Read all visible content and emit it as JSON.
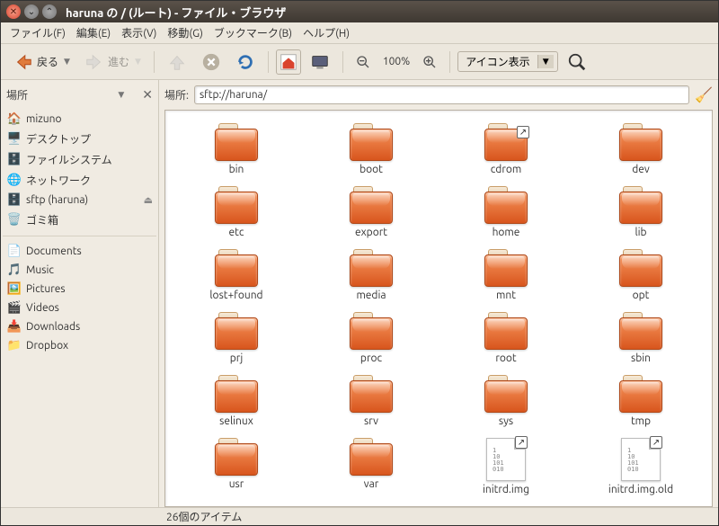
{
  "window_title": "haruna の / (ルート) - ファイル・ブラウザ",
  "menu": [
    "ファイル(F)",
    "編集(E)",
    "表示(V)",
    "移動(G)",
    "ブックマーク(B)",
    "ヘルプ(H)"
  ],
  "toolbar": {
    "back": "戻る",
    "forward": "進む",
    "zoom": "100%",
    "view_mode": "アイコン表示"
  },
  "side": {
    "header": "場所",
    "places": [
      {
        "icon": "🏠",
        "label": "mizuno",
        "color": "#d9432e"
      },
      {
        "icon": "🖥️",
        "label": "デスクトップ",
        "color": "#7a4ea0"
      },
      {
        "icon": "🗄️",
        "label": "ファイルシステム",
        "color": "#888"
      },
      {
        "icon": "🌐",
        "label": "ネットワーク",
        "color": "#4a7dbf"
      },
      {
        "icon": "🗄️",
        "label": "sftp (haruna)",
        "color": "#888",
        "eject": true
      },
      {
        "icon": "🗑️",
        "label": "ゴミ箱",
        "color": "#888"
      }
    ],
    "bookmarks": [
      {
        "icon": "📄",
        "label": "Documents"
      },
      {
        "icon": "🎵",
        "label": "Music"
      },
      {
        "icon": "🖼️",
        "label": "Pictures"
      },
      {
        "icon": "🎬",
        "label": "Videos"
      },
      {
        "icon": "📥",
        "label": "Downloads"
      },
      {
        "icon": "📁",
        "label": "Dropbox"
      }
    ]
  },
  "location": {
    "label": "場所:",
    "value": "sftp://haruna/"
  },
  "items": [
    {
      "name": "bin",
      "type": "folder"
    },
    {
      "name": "boot",
      "type": "folder"
    },
    {
      "name": "cdrom",
      "type": "folder",
      "link": true
    },
    {
      "name": "dev",
      "type": "folder"
    },
    {
      "name": "etc",
      "type": "folder"
    },
    {
      "name": "export",
      "type": "folder"
    },
    {
      "name": "home",
      "type": "folder"
    },
    {
      "name": "lib",
      "type": "folder"
    },
    {
      "name": "lost+found",
      "type": "folder"
    },
    {
      "name": "media",
      "type": "folder"
    },
    {
      "name": "mnt",
      "type": "folder"
    },
    {
      "name": "opt",
      "type": "folder"
    },
    {
      "name": "prj",
      "type": "folder"
    },
    {
      "name": "proc",
      "type": "folder"
    },
    {
      "name": "root",
      "type": "folder"
    },
    {
      "name": "sbin",
      "type": "folder"
    },
    {
      "name": "selinux",
      "type": "folder"
    },
    {
      "name": "srv",
      "type": "folder"
    },
    {
      "name": "sys",
      "type": "folder"
    },
    {
      "name": "tmp",
      "type": "folder"
    },
    {
      "name": "usr",
      "type": "folder"
    },
    {
      "name": "var",
      "type": "folder"
    },
    {
      "name": "initrd.img",
      "type": "file",
      "link": true
    },
    {
      "name": "initrd.img.old",
      "type": "file",
      "link": true
    }
  ],
  "status": "26個のアイテム"
}
